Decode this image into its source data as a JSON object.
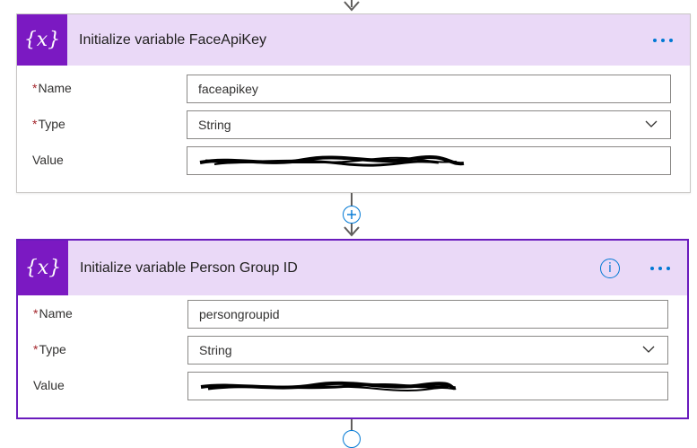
{
  "cards": [
    {
      "icon_glyph": "{x}",
      "title": "Initialize variable FaceApiKey",
      "fields": {
        "name_label": "Name",
        "name_value": "faceapikey",
        "type_label": "Type",
        "type_value": "String",
        "value_label": "Value",
        "value_value": ""
      }
    },
    {
      "icon_glyph": "{x}",
      "title": "Initialize variable Person Group ID",
      "fields": {
        "name_label": "Name",
        "name_value": "persongroupid",
        "type_label": "Type",
        "type_value": "String",
        "value_label": "Value",
        "value_value": ""
      }
    }
  ],
  "required_marker": "*",
  "info_glyph": "i",
  "colors": {
    "header_bg": "#ead9f7",
    "icon_bg": "#7b19c2",
    "accent_blue": "#0078d4",
    "selected_border": "#6a1bbd",
    "required": "#a4262c"
  },
  "icons": [
    "variable-icon",
    "more-options-icon",
    "info-icon",
    "chevron-down-icon",
    "add-step-icon",
    "arrow-down-icon"
  ]
}
